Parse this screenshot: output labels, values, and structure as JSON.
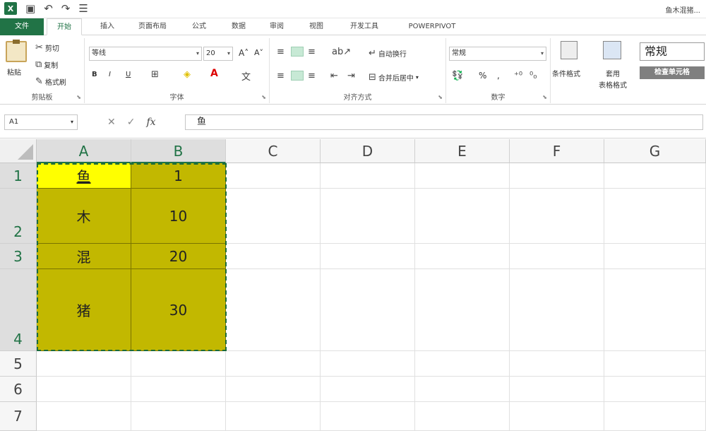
{
  "titlebar": {
    "app_title": "鱼木混猪..."
  },
  "tabs": [
    {
      "label": "文件"
    },
    {
      "label": "开始"
    },
    {
      "label": "插入"
    },
    {
      "label": "页面布局"
    },
    {
      "label": "公式"
    },
    {
      "label": "数据"
    },
    {
      "label": "审阅"
    },
    {
      "label": "视图"
    },
    {
      "label": "开发工具"
    },
    {
      "label": "POWERPIVOT"
    }
  ],
  "ribbon": {
    "clipboard": {
      "paste": "粘贴",
      "cut": "剪切",
      "copy": "复制",
      "format_painter": "格式刷",
      "label": "剪贴板"
    },
    "font": {
      "name": "等线",
      "size": "20",
      "label": "字体",
      "bold": "B",
      "italic": "I",
      "underline": "U"
    },
    "alignment": {
      "wrap_text": "自动换行",
      "merge_center": "合并后居中",
      "label": "对齐方式"
    },
    "number": {
      "format": "常规",
      "label": "数字",
      "percent": "%",
      "comma": ","
    },
    "styles": {
      "conditional": "条件格式",
      "table_format_1": "套用",
      "table_format_2": "表格格式",
      "normal_style": "常规",
      "check_cell": "检查单元格"
    }
  },
  "formula_bar": {
    "name_box": "A1",
    "fx": "fx",
    "cancel": "✕",
    "enter": "✓",
    "value": "鱼"
  },
  "sheet": {
    "columns": [
      "A",
      "B",
      "C",
      "D",
      "E",
      "F",
      "G"
    ],
    "rows": [
      "1",
      "2",
      "3",
      "4",
      "5",
      "6",
      "7"
    ],
    "cells": {
      "A1": "鱼",
      "B1": "1",
      "A2": "木",
      "B2": "10",
      "A3": "混",
      "B3": "20",
      "A4": "猪",
      "B4": "30"
    }
  }
}
